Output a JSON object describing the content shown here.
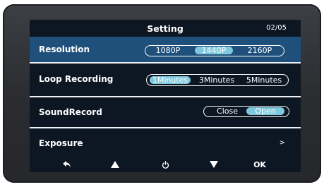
{
  "header": {
    "title": "Setting",
    "page_counter": "02/05"
  },
  "menu": {
    "resolution": {
      "label": "Resolution",
      "options": [
        "1080P",
        "1440P",
        "2160P"
      ],
      "selected": "1440P"
    },
    "loop_recording": {
      "label": "Loop Recording",
      "options": [
        "1Minutes",
        "3Minutes",
        "5Minutes"
      ],
      "selected": "1Minutes"
    },
    "sound_record": {
      "label": "SoundRecord",
      "options": [
        "Close",
        "Open"
      ],
      "selected": "Open"
    },
    "exposure": {
      "label": "Exposure",
      "chevron": ">"
    }
  },
  "nav": {
    "icons": [
      "back-arrow-icon",
      "up-triangle-icon",
      "power-icon",
      "down-triangle-icon"
    ],
    "ok_label": "OK"
  },
  "colors": {
    "selected_row": "#1f507c",
    "active_option": "#7ec9de",
    "screen_background": "#0d1623",
    "bezel": "#2f3136"
  }
}
